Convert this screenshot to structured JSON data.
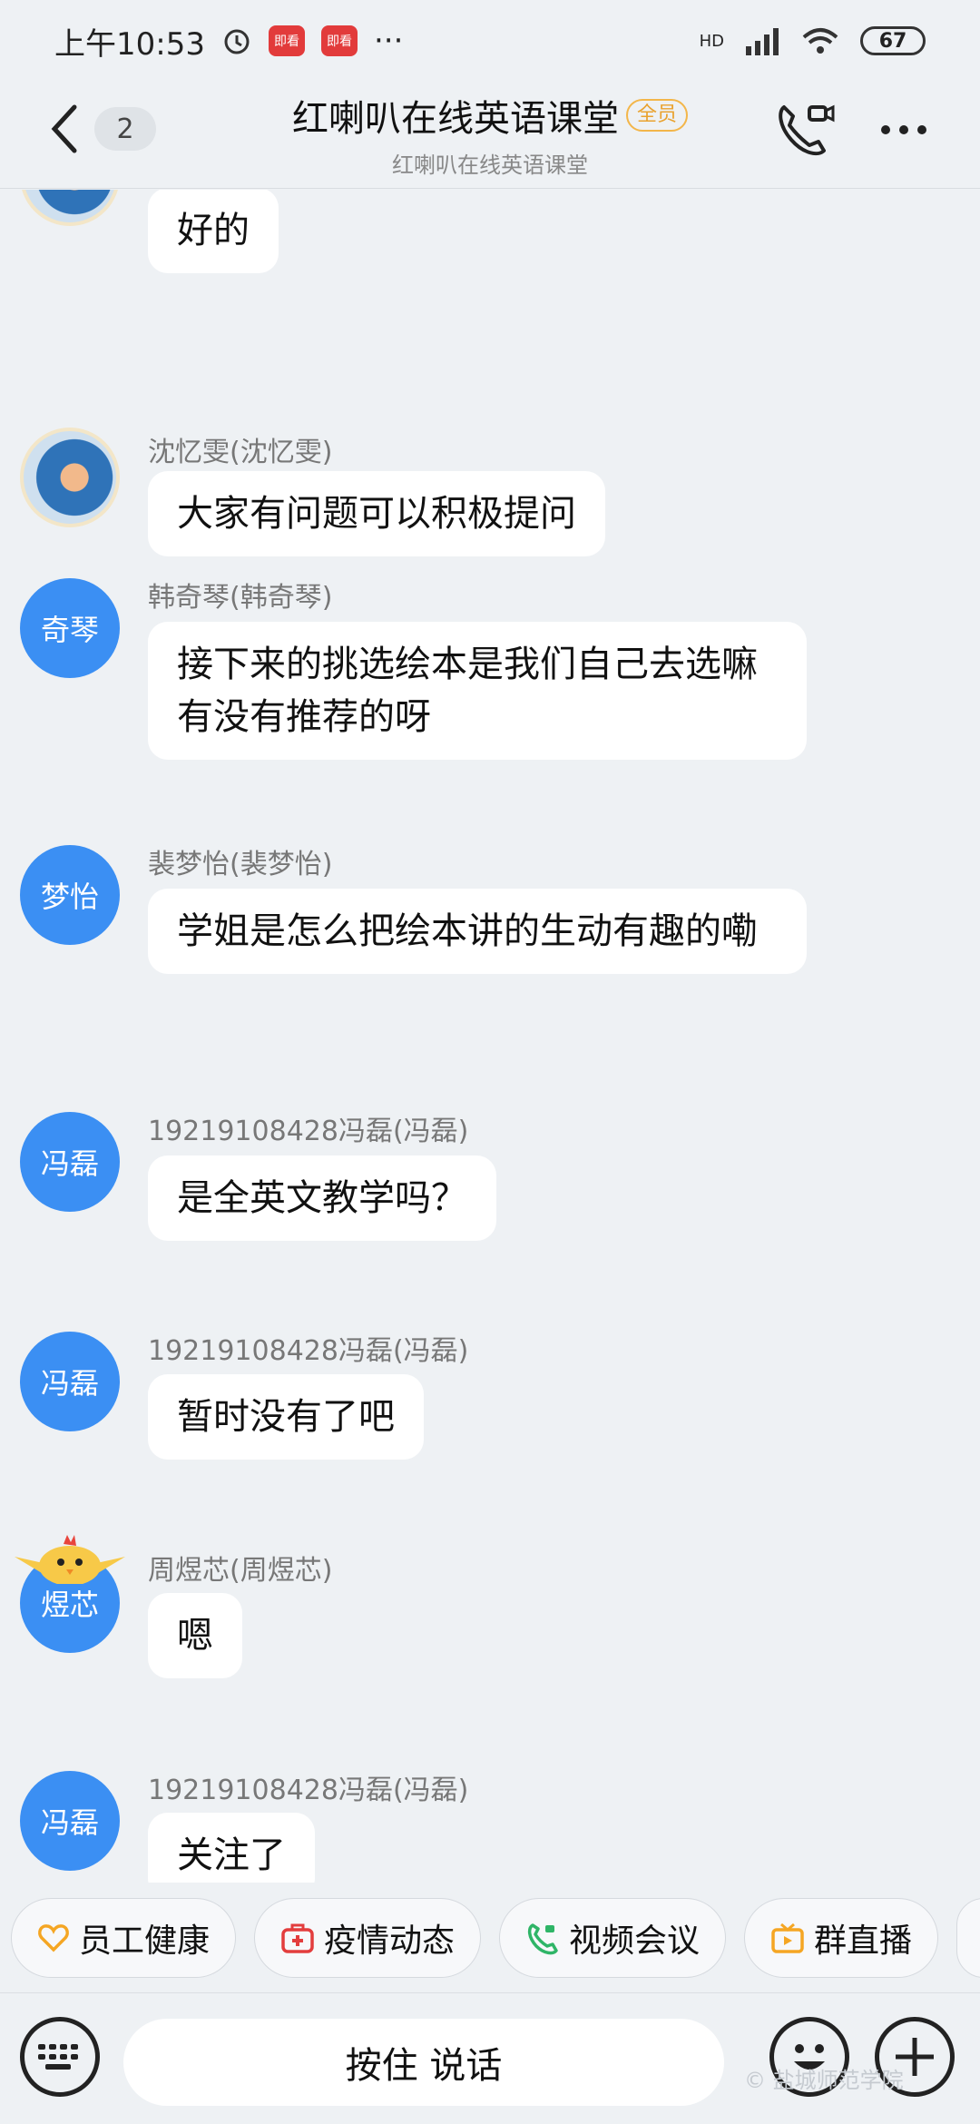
{
  "status_bar": {
    "time": "上午10:53",
    "app_badge": "即看",
    "more": "···",
    "network": "HD",
    "battery": "67"
  },
  "header": {
    "unread_count": "2",
    "title": "红喇叭在线英语课堂",
    "member_tag": "全员",
    "subtitle": "红喇叭在线英语课堂"
  },
  "messages": [
    {
      "sender": "",
      "avatar": "",
      "text": "好的"
    },
    {
      "sender": "沈忆雯(沈忆雯)",
      "avatar": "",
      "text": "大家有问题可以积极提问"
    },
    {
      "sender": "韩奇琴(韩奇琴)",
      "avatar": "奇琴",
      "text": "接下来的挑选绘本是我们自己去选嘛 有没有推荐的呀"
    },
    {
      "sender": "裴梦怡(裴梦怡)",
      "avatar": "梦怡",
      "text": "学姐是怎么把绘本讲的生动有趣的嘞"
    },
    {
      "sender": "19219108428冯磊(冯磊)",
      "avatar": "冯磊",
      "text": "是全英文教学吗？"
    },
    {
      "sender": "19219108428冯磊(冯磊)",
      "avatar": "冯磊",
      "text": "暂时没有了吧"
    },
    {
      "sender": "周煜芯(周煜芯)",
      "avatar": "煜芯",
      "text": "嗯"
    },
    {
      "sender": "19219108428冯磊(冯磊)",
      "avatar": "冯磊",
      "text": "关注了"
    }
  ],
  "quick_actions": [
    {
      "label": "员工健康",
      "icon": "heart-icon",
      "color": "#f5a623"
    },
    {
      "label": "疫情动态",
      "icon": "medical-kit-icon",
      "color": "#e33d3d"
    },
    {
      "label": "视频会议",
      "icon": "video-call-icon",
      "color": "#2fb567"
    },
    {
      "label": "群直播",
      "icon": "tv-icon",
      "color": "#f5a623"
    }
  ],
  "input": {
    "hold_to_talk": "按住 说话"
  },
  "watermark": "© 盐城师范学院"
}
